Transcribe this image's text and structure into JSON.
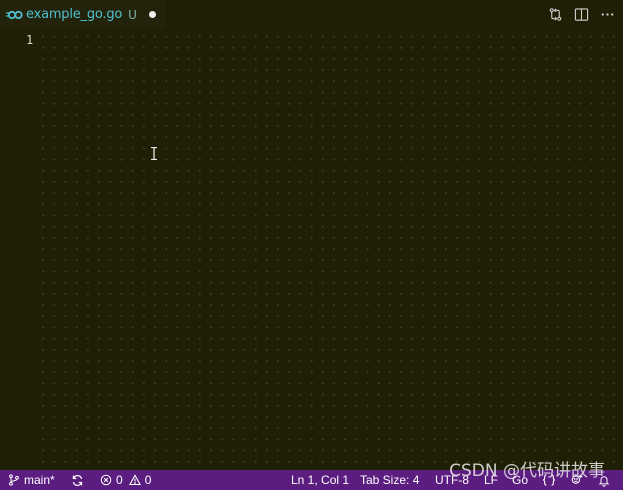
{
  "tab": {
    "filename": "example_go.go",
    "status": "U",
    "icon": "go-file-icon",
    "filename_color": "#4fc0d0"
  },
  "editor": {
    "line_numbers": [
      "1"
    ],
    "background": "#1f1f05"
  },
  "statusbar": {
    "background": "#5c1d80",
    "branch": "main*",
    "errors": "0",
    "warnings": "0",
    "cursor_position": "Ln 1, Col 1",
    "tab_size": "Tab Size: 4",
    "encoding": "UTF-8",
    "eol": "LF",
    "language": "Go"
  },
  "watermark": "CSDN @代码讲故事"
}
